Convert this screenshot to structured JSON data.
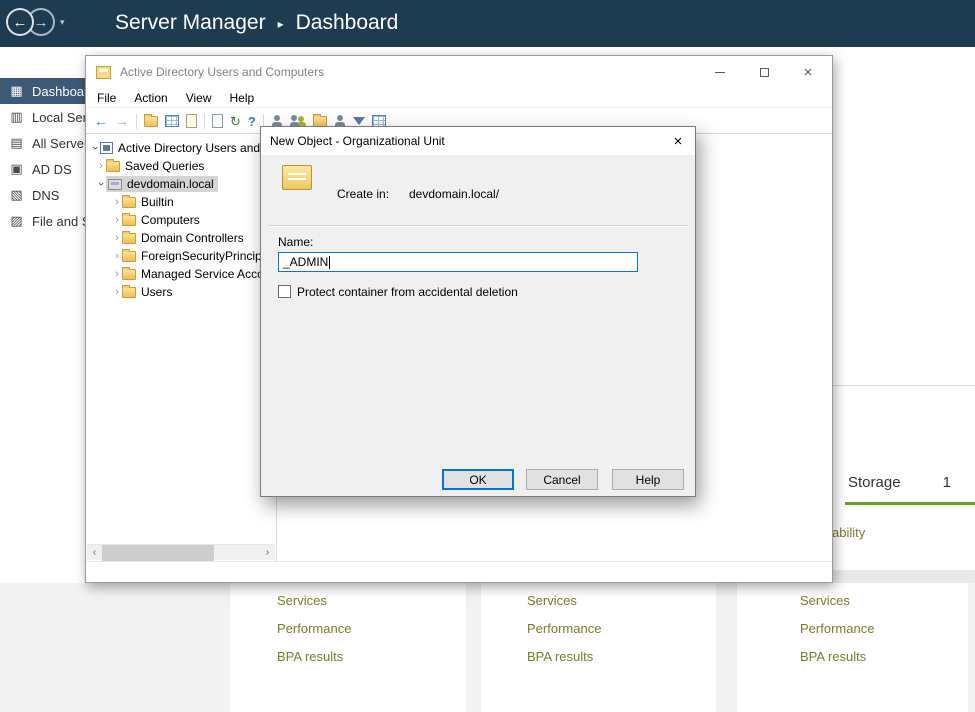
{
  "topbar": {
    "title_left": "Server Manager",
    "separator": "▸",
    "title_right": "Dashboard",
    "icons": [
      "back-nav-icon",
      "forward-nav-icon",
      "dropdown-caret-icon"
    ],
    "bg_color": "#1e3c51"
  },
  "sidebar": {
    "active_bg": "#3c5a75",
    "items": [
      {
        "label": "Dashboard",
        "icon": "dashboard-icon",
        "active": true
      },
      {
        "label": "Local Server",
        "icon": "local-server-icon",
        "active": false
      },
      {
        "label": "All Servers",
        "icon": "all-servers-icon",
        "active": false
      },
      {
        "label": "AD DS",
        "icon": "ad-ds-icon",
        "active": false
      },
      {
        "label": "DNS",
        "icon": "dns-icon",
        "active": false
      },
      {
        "label": "File and Storage Services",
        "icon": "file-storage-icon",
        "active": false
      }
    ]
  },
  "aduc": {
    "title": "Active Directory Users and Computers",
    "window_icons": [
      "minimize-icon",
      "maximize-icon",
      "close-icon"
    ],
    "menu": [
      "File",
      "Action",
      "View",
      "Help"
    ],
    "toolbar_icons": [
      "back-icon",
      "forward-icon",
      "up-one-level-icon",
      "export-list-icon",
      "properties-icon",
      "create-user-icon",
      "create-group-icon",
      "create-ou-icon",
      "add-to-group-icon",
      "set-filter-icon",
      "refresh-icon",
      "help-icon",
      "list-view-icon",
      "document-icon"
    ],
    "tree": {
      "root_label": "Active Directory Users and Computers",
      "items": [
        {
          "label": "Saved Queries",
          "state": "collapsed",
          "selected": false
        },
        {
          "label": "devdomain.local",
          "state": "expanded",
          "selected": true
        },
        {
          "label": "Builtin",
          "state": "collapsed",
          "selected": false
        },
        {
          "label": "Computers",
          "state": "collapsed",
          "selected": false
        },
        {
          "label": "Domain Controllers",
          "state": "collapsed",
          "selected": false
        },
        {
          "label": "ForeignSecurityPrincipals",
          "state": "collapsed",
          "selected": false
        },
        {
          "label": "Managed Service Accounts",
          "state": "collapsed",
          "selected": false
        },
        {
          "label": "Users",
          "state": "collapsed",
          "selected": false
        }
      ]
    }
  },
  "dialog": {
    "title": "New Object - Organizational Unit",
    "close_icon": "close-icon",
    "object_icon": "organizational-unit-icon",
    "create_in_label": "Create in:",
    "create_in_value": "devdomain.local/",
    "name_label": "Name:",
    "name_value": "_ADMIN",
    "checkbox_label": "Protect container from accidental deletion",
    "checkbox_checked": false,
    "focus_border_color": "#0078d7",
    "buttons": [
      {
        "label": "OK",
        "primary": true
      },
      {
        "label": "Cancel",
        "primary": false
      },
      {
        "label": "Help",
        "primary": false
      }
    ]
  },
  "dashboard": {
    "storage_panel": {
      "title": "Storage",
      "count": "1",
      "link": "Manageability",
      "accent_color": "#6aa21f"
    },
    "link_color": "#7c7d26",
    "tiles": [
      {
        "links": [
          "Services",
          "Performance",
          "BPA results"
        ]
      },
      {
        "links": [
          "Services",
          "Performance",
          "BPA results"
        ]
      },
      {
        "links": [
          "Services",
          "Performance",
          "BPA results"
        ]
      }
    ]
  }
}
